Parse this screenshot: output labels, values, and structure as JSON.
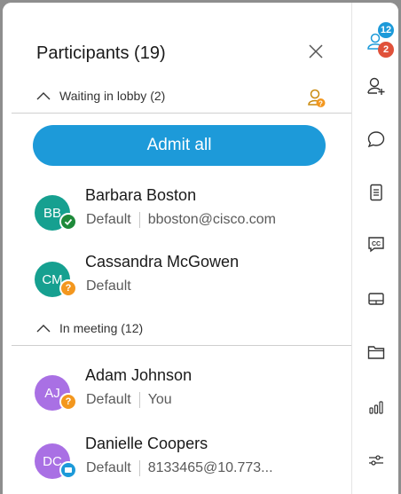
{
  "panel": {
    "title": "Participants (19)",
    "admit_all_label": "Admit all"
  },
  "lobby": {
    "label": "Waiting in lobby (2)",
    "participants": [
      {
        "initials": "BB",
        "name": "Barbara Boston",
        "role": "Default",
        "detail": "bboston@cisco.com",
        "avatar_color": "#16a090",
        "status": "check",
        "status_color": "#1e8a3a"
      },
      {
        "initials": "CM",
        "name": "Cassandra McGowen",
        "role": "Default",
        "detail": "",
        "avatar_color": "#16a090",
        "status": "question",
        "status_color": "#f3971e"
      }
    ]
  },
  "meeting": {
    "label": "In meeting (12)",
    "participants": [
      {
        "initials": "AJ",
        "name": "Adam Johnson",
        "role": "Default",
        "detail": "You",
        "avatar_color": "#a970e4",
        "status": "question",
        "status_color": "#f3971e"
      },
      {
        "initials": "DC",
        "name": "Danielle Coopers",
        "role": "Default",
        "detail": "8133465@10.773...",
        "avatar_color": "#a970e4",
        "status": "device",
        "status_color": "#1d9ad9"
      }
    ]
  },
  "rail": {
    "participants_count": "12",
    "lobby_count": "2",
    "icons": [
      "participants-icon",
      "add-participant-icon",
      "chat-icon",
      "notes-icon",
      "closed-captions-icon",
      "layout-icon",
      "files-icon",
      "polling-icon",
      "settings-sliders-icon"
    ]
  },
  "colors": {
    "accent": "#1d9ad9",
    "warning": "#f3971e",
    "alert": "#e0513a"
  }
}
